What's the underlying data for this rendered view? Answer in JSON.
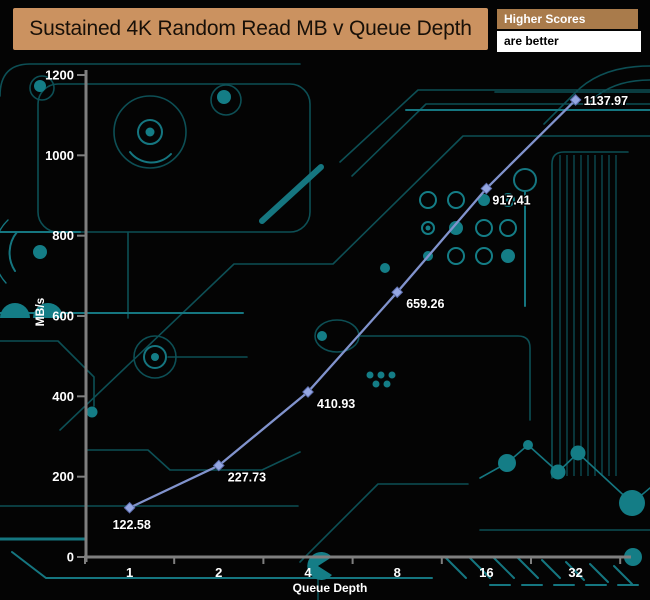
{
  "title": {
    "text": "Sustained 4K Random Read MB v Queue Depth"
  },
  "legend": {
    "higher_scores": "Higher Scores",
    "are_better": "are better"
  },
  "chart_data": {
    "type": "line",
    "x": [
      1,
      2,
      4,
      8,
      16,
      32
    ],
    "categories": [
      "1",
      "2",
      "4",
      "8",
      "16",
      "32"
    ],
    "series": [
      {
        "name": "Sustained 4K Random Read MB/s",
        "values": [
          122.58,
          227.73,
          410.93,
          659.26,
          917.41,
          1137.97
        ]
      }
    ],
    "point_labels": [
      "122.58",
      "227.73",
      "410.93",
      "659.26",
      "917.41",
      "1137.97"
    ],
    "xlabel": "Queue Depth",
    "ylabel": "MB/s",
    "ylim": [
      0,
      1200
    ],
    "yticks": [
      0,
      200,
      400,
      600,
      800,
      1000,
      1200
    ],
    "x_axis_type": "categorical-log2",
    "grid": false,
    "legend_position": "none",
    "marker": "diamond"
  },
  "colors": {
    "background": "#040404",
    "circuit_teal_bright": "#157680",
    "circuit_teal_dim": "#0d4f55",
    "circuit_pad_fill": "#147d86",
    "axis_gray": "#7f7f7f",
    "line": "#8193cd",
    "marker_fill": "#94a6e2",
    "marker_stroke": "#5f6fae",
    "label_text": "#ffffff",
    "title_bg": "#cb9260",
    "higher_scores_bg": "#a97b4b",
    "are_better_bg": "#ffffff"
  }
}
